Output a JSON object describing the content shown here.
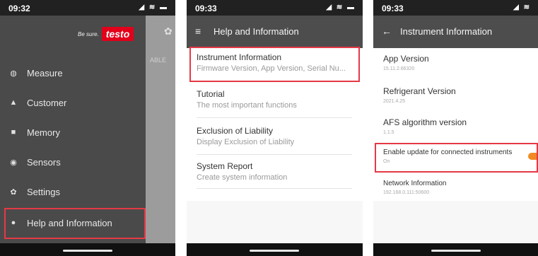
{
  "phone1": {
    "time": "09:32",
    "status_icons": "◢ ≋ ▬",
    "slogan": "Be sure.",
    "logo": "testo",
    "behind_tab_text": "ABLE",
    "menu": [
      {
        "icon": "gauge-icon",
        "glyph": "◍",
        "label": "Measure"
      },
      {
        "icon": "person-icon",
        "glyph": "▲",
        "label": "Customer"
      },
      {
        "icon": "memory-icon",
        "glyph": "■",
        "label": "Memory"
      },
      {
        "icon": "sensors-icon",
        "glyph": "◉",
        "label": "Sensors"
      },
      {
        "icon": "gear-icon",
        "glyph": "✿",
        "label": "Settings"
      },
      {
        "icon": "help-icon",
        "glyph": "●",
        "label": "Help and Information"
      }
    ]
  },
  "phone2": {
    "time": "09:33",
    "status_icons": "◢ ≋ ▬",
    "title": "Help and Information",
    "items": [
      {
        "title": "Instrument Information",
        "subtitle": "Firmware Version, App Version, Serial Nu..."
      },
      {
        "title": "Tutorial",
        "subtitle": "The most important functions"
      },
      {
        "title": "Exclusion of Liability",
        "subtitle": "Display Exclusion of Liability"
      },
      {
        "title": "System Report",
        "subtitle": "Create system information"
      }
    ]
  },
  "phone3": {
    "time": "09:33",
    "status_icons": "◢ ≋",
    "title": "Instrument Information",
    "items": [
      {
        "title": "App Version",
        "value": "15.11.2.66320"
      },
      {
        "title": "Refrigerant Version",
        "value": "2021.4.25"
      },
      {
        "title": "AFS algorithm version",
        "value": "1.1.5"
      },
      {
        "title": "Enable update for connected instruments",
        "value": "On"
      },
      {
        "title": "Network Information",
        "value": "192.168.0.111:50600"
      }
    ]
  },
  "colors": {
    "highlight": "#e53945",
    "brand": "#e2001a",
    "toggle": "#f08a24",
    "bar": "#4d4d4d"
  }
}
